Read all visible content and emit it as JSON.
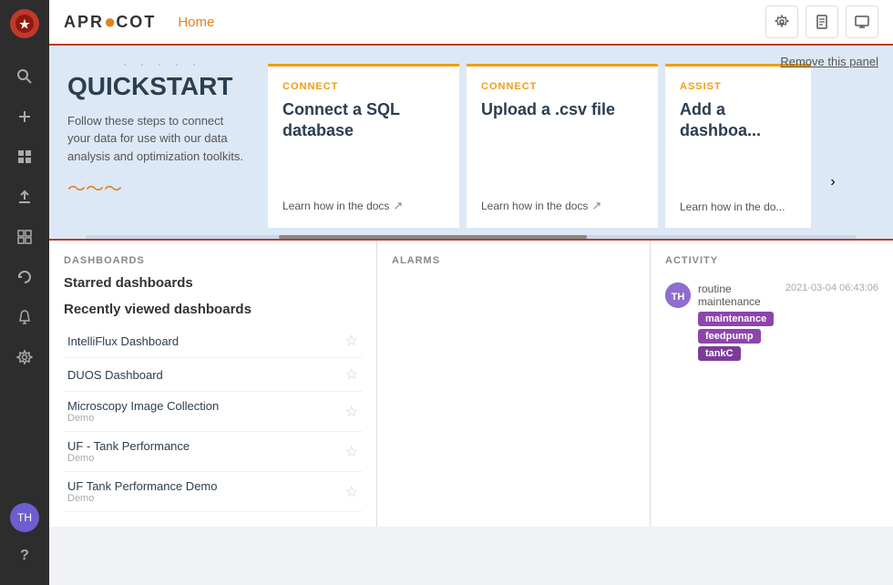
{
  "sidebar": {
    "logo_text": "★",
    "icons": [
      {
        "name": "search-icon",
        "glyph": "🔍"
      },
      {
        "name": "plus-icon",
        "glyph": "+"
      },
      {
        "name": "grid-icon",
        "glyph": "⊞"
      },
      {
        "name": "upload-icon",
        "glyph": "↑"
      },
      {
        "name": "tiles-icon",
        "glyph": "▦"
      },
      {
        "name": "refresh-icon",
        "glyph": "↻"
      },
      {
        "name": "bell-icon",
        "glyph": "🔔"
      },
      {
        "name": "settings-icon",
        "glyph": "⚙"
      }
    ],
    "avatar_initials": "TH",
    "help_icon": "?"
  },
  "header": {
    "logo": "APRICOT",
    "logo_accent": "●",
    "nav": [
      {
        "label": "Home"
      }
    ],
    "buttons": [
      {
        "name": "gear-btn",
        "icon": "⚙"
      },
      {
        "name": "doc-btn",
        "icon": "📄"
      },
      {
        "name": "monitor-btn",
        "icon": "🖥"
      }
    ]
  },
  "quickstart": {
    "remove_label": "Remove this panel",
    "title": "QUICKSTART",
    "description": "Follow these steps to connect your data for use with our data analysis and optimization toolkits.",
    "wave": "〜〜〜",
    "cards": [
      {
        "type": "CONNECT",
        "title": "Connect a SQL database",
        "link": "Learn how in the docs"
      },
      {
        "type": "CONNECT",
        "title": "Upload a .csv file",
        "link": "Learn how in the docs"
      },
      {
        "type": "ASSIST",
        "title": "Add a dashboa...",
        "link": "Learn how in the do..."
      }
    ],
    "arrow": "›"
  },
  "dashboards": {
    "section_title": "DASHBOARDS",
    "starred_label": "Starred dashboards",
    "recent_label": "Recently viewed dashboards",
    "items": [
      {
        "name": "IntelliFlux Dashboard",
        "tag": ""
      },
      {
        "name": "DUOS Dashboard",
        "tag": ""
      },
      {
        "name": "Microscopy Image Collection",
        "tag": "Demo"
      },
      {
        "name": "UF - Tank Performance",
        "tag": "Demo"
      },
      {
        "name": "UF Tank Performance Demo",
        "tag": "Demo"
      }
    ]
  },
  "alarms": {
    "section_title": "ALARMS"
  },
  "activity": {
    "section_title": "ACTIVITY",
    "items": [
      {
        "avatar": "TH",
        "text_before": "routine maintenance",
        "tags": [
          {
            "label": "maintenance",
            "class": "tag-maintenance"
          },
          {
            "label": "feedpump",
            "class": "tag-feedpump"
          },
          {
            "label": "tankC",
            "class": "tag-tankc"
          }
        ],
        "timestamp": "2021-03-04 06:43:06"
      }
    ]
  }
}
